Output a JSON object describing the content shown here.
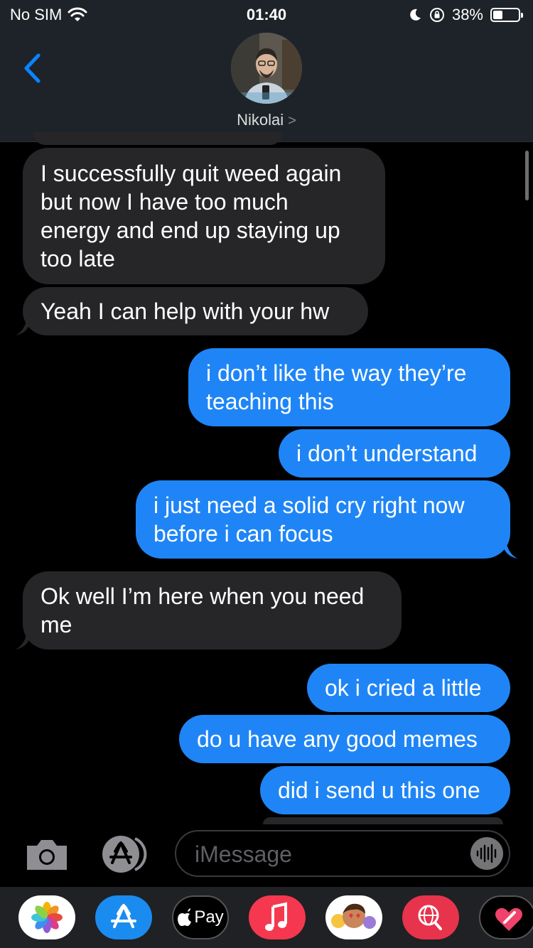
{
  "status_bar": {
    "carrier": "No SIM",
    "time": "01:40",
    "battery_percent": "38%",
    "battery_level": 0.38
  },
  "header": {
    "contact_name": "Nikolai",
    "avatar_caption": "Nikolai"
  },
  "messages": [
    {
      "direction": "incoming",
      "text_lines": [
        "I successfully quit weed again",
        "but now I have too much",
        "energy and end up staying up",
        "too late"
      ]
    },
    {
      "direction": "incoming",
      "text_lines": [
        "Yeah I can help with your hw"
      ]
    },
    {
      "direction": "outgoing",
      "text_lines": [
        "i don’t like the way they’re",
        "teaching this"
      ]
    },
    {
      "direction": "outgoing",
      "text_lines": [
        "i don’t understand"
      ]
    },
    {
      "direction": "outgoing",
      "text_lines": [
        "i just need a solid cry right now",
        "before i can focus"
      ]
    },
    {
      "direction": "incoming",
      "text_lines": [
        "Ok well I’m here when you need",
        "me"
      ]
    },
    {
      "direction": "outgoing",
      "text_lines": [
        "ok i cried a little"
      ]
    },
    {
      "direction": "outgoing",
      "text_lines": [
        "do u have any good memes"
      ]
    },
    {
      "direction": "outgoing",
      "text_lines": [
        "did i send u this one"
      ]
    }
  ],
  "input_bar": {
    "placeholder": "iMessage"
  },
  "app_drawer": {
    "items": [
      "photos",
      "app-store",
      "apple-pay",
      "music",
      "memoji",
      "web-search",
      "digital-touch"
    ],
    "apple_pay_label": "Pay"
  },
  "colors": {
    "outgoing_bubble": "#1f85f6",
    "incoming_bubble": "#262628",
    "accent": "#0a84ff",
    "background": "#000000"
  }
}
